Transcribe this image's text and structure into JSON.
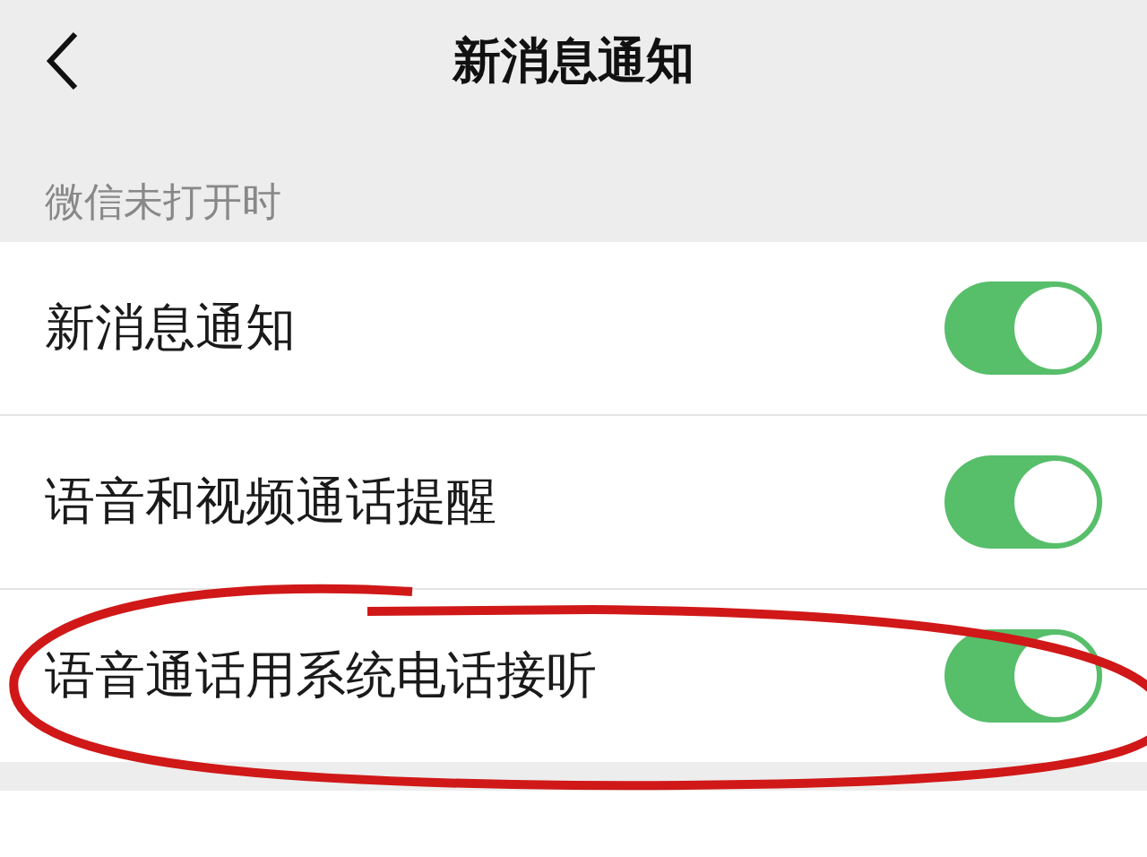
{
  "nav_bar": {
    "title": "新消息通知"
  },
  "section": {
    "label": "微信未打开时"
  },
  "settings": [
    {
      "label": "新消息通知",
      "on": true
    },
    {
      "label": "语音和视频通话提醒",
      "on": true
    },
    {
      "label": "语音通话用系统电话接听",
      "on": true
    }
  ]
}
